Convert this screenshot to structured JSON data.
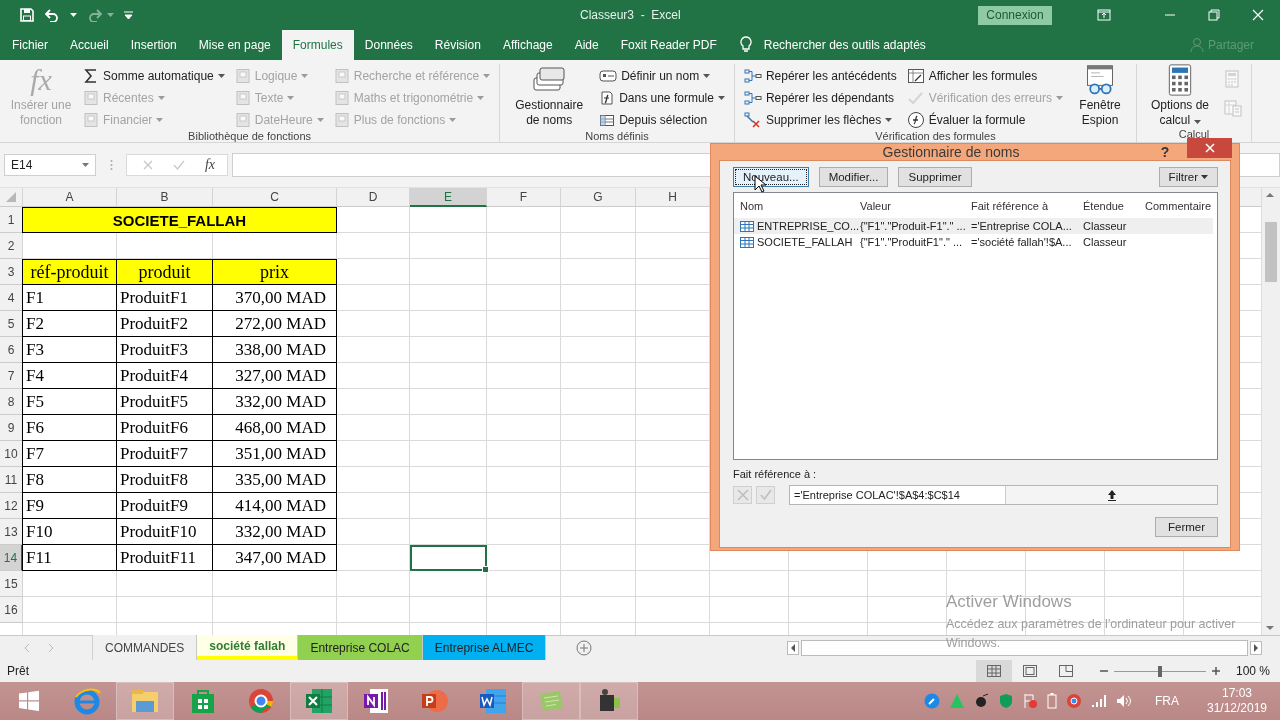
{
  "window": {
    "title": "Classeur3  -  Excel",
    "signin_button": "Connexion"
  },
  "ribbon_tabs": [
    {
      "label": "Fichier",
      "selected": false
    },
    {
      "label": "Accueil",
      "selected": false
    },
    {
      "label": "Insertion",
      "selected": false
    },
    {
      "label": "Mise en page",
      "selected": false
    },
    {
      "label": "Formules",
      "selected": true
    },
    {
      "label": "Données",
      "selected": false
    },
    {
      "label": "Révision",
      "selected": false
    },
    {
      "label": "Affichage",
      "selected": false
    },
    {
      "label": "Aide",
      "selected": false
    },
    {
      "label": "Foxit Reader PDF",
      "selected": false
    }
  ],
  "tell_me": "Rechercher des outils adaptés",
  "share": {
    "label": "Partager",
    "disabled": true
  },
  "ribbon_groups": [
    {
      "label": "Bibliothèque de fonctions",
      "controls": [
        {
          "kind": "large",
          "icon_text": "fx",
          "label": "Insérer une fonction",
          "disabled": true,
          "dropdown": false
        },
        {
          "kind": "column",
          "items": [
            {
              "label": "Somme automatique",
              "disabled": false,
              "dropdown": true
            },
            {
              "label": "Récentes",
              "disabled": true,
              "dropdown": true
            },
            {
              "label": "Financier",
              "disabled": true,
              "dropdown": true
            }
          ]
        },
        {
          "kind": "column",
          "items": [
            {
              "label": "Logique",
              "disabled": true,
              "dropdown": true
            },
            {
              "label": "Texte",
              "disabled": true,
              "dropdown": true
            },
            {
              "label": "DateHeure",
              "disabled": true,
              "dropdown": true
            }
          ]
        },
        {
          "kind": "column",
          "items": [
            {
              "label": "Recherche et référence",
              "disabled": true,
              "dropdown": true
            },
            {
              "label": "Maths et trigonométrie",
              "disabled": true,
              "dropdown": true
            },
            {
              "label": "Plus de fonctions",
              "disabled": true,
              "dropdown": true
            }
          ]
        }
      ]
    },
    {
      "label": "Noms définis",
      "controls": [
        {
          "kind": "large",
          "label": "Gestionnaire de noms",
          "disabled": false,
          "dropdown": false
        },
        {
          "kind": "column",
          "items": [
            {
              "label": "Définir un nom",
              "disabled": false,
              "dropdown": true
            },
            {
              "label": "Dans une formule",
              "disabled": false,
              "dropdown": true
            },
            {
              "label": "Depuis sélection",
              "disabled": false,
              "dropdown": false
            }
          ]
        }
      ]
    },
    {
      "label": "Vérification des formules",
      "controls": [
        {
          "kind": "column",
          "items": [
            {
              "label": "Repérer les antécédents",
              "disabled": false,
              "dropdown": false
            },
            {
              "label": "Repérer les dépendants",
              "disabled": false,
              "dropdown": false
            },
            {
              "label": "Supprimer les flèches",
              "disabled": false,
              "dropdown": true
            }
          ]
        },
        {
          "kind": "column",
          "items": [
            {
              "label": "Afficher les formules",
              "disabled": false,
              "dropdown": false
            },
            {
              "label": "Vérification des erreurs",
              "disabled": true,
              "dropdown": true
            },
            {
              "label": "Évaluer la formule",
              "disabled": false,
              "dropdown": false
            }
          ]
        },
        {
          "kind": "large",
          "label": "Fenêtre Espion",
          "disabled": false,
          "dropdown": false
        }
      ]
    },
    {
      "label": "Calcul",
      "controls": [
        {
          "kind": "large",
          "label": "Options de calcul",
          "disabled": false,
          "dropdown": true
        },
        {
          "kind": "icons",
          "items": [
            {
              "disabled": true
            },
            {
              "disabled": true
            }
          ]
        }
      ]
    }
  ],
  "formula_bar": {
    "name_box": "E14",
    "fx": "fx"
  },
  "columns": [
    {
      "label": "A",
      "selected": false
    },
    {
      "label": "B",
      "selected": false
    },
    {
      "label": "C",
      "selected": false
    },
    {
      "label": "D",
      "selected": false
    },
    {
      "label": "E",
      "selected": true
    },
    {
      "label": "F",
      "selected": false
    },
    {
      "label": "G",
      "selected": false
    },
    {
      "label": "H",
      "selected": false
    }
  ],
  "rows": [
    {
      "number": "1",
      "selected": false,
      "cells": [
        {
          "kind": "title",
          "text": "SOCIETE_FALLAH"
        }
      ]
    },
    {
      "number": "2",
      "selected": false
    },
    {
      "number": "3",
      "selected": false,
      "cells": [
        {
          "kind": "header",
          "text": "réf-produit"
        },
        {
          "kind": "header",
          "text": "produit"
        },
        {
          "kind": "header",
          "text": "prix"
        }
      ]
    },
    {
      "number": "4",
      "selected": false,
      "cells": [
        {
          "kind": "text",
          "text": "F1"
        },
        {
          "kind": "text",
          "text": "ProduitF1"
        },
        {
          "kind": "amount",
          "text": "370,00 MAD"
        }
      ]
    },
    {
      "number": "5",
      "selected": false,
      "cells": [
        {
          "kind": "text",
          "text": "F2"
        },
        {
          "kind": "text",
          "text": "ProduitF2"
        },
        {
          "kind": "amount",
          "text": "272,00 MAD"
        }
      ]
    },
    {
      "number": "6",
      "selected": false,
      "cells": [
        {
          "kind": "text",
          "text": "F3"
        },
        {
          "kind": "text",
          "text": "ProduitF3"
        },
        {
          "kind": "amount",
          "text": "338,00 MAD"
        }
      ]
    },
    {
      "number": "7",
      "selected": false,
      "cells": [
        {
          "kind": "text",
          "text": "F4"
        },
        {
          "kind": "text",
          "text": "ProduitF4"
        },
        {
          "kind": "amount",
          "text": "327,00 MAD"
        }
      ]
    },
    {
      "number": "8",
      "selected": false,
      "cells": [
        {
          "kind": "text",
          "text": "F5"
        },
        {
          "kind": "text",
          "text": "ProduitF5"
        },
        {
          "kind": "amount",
          "text": "332,00 MAD"
        }
      ]
    },
    {
      "number": "9",
      "selected": false,
      "cells": [
        {
          "kind": "text",
          "text": "F6"
        },
        {
          "kind": "text",
          "text": "ProduitF6"
        },
        {
          "kind": "amount",
          "text": "468,00 MAD"
        }
      ]
    },
    {
      "number": "10",
      "selected": false,
      "cells": [
        {
          "kind": "text",
          "text": "F7"
        },
        {
          "kind": "text",
          "text": "ProduitF7"
        },
        {
          "kind": "amount",
          "text": "351,00 MAD"
        }
      ]
    },
    {
      "number": "11",
      "selected": false,
      "cells": [
        {
          "kind": "text",
          "text": "F8"
        },
        {
          "kind": "text",
          "text": "ProduitF8"
        },
        {
          "kind": "amount",
          "text": "335,00 MAD"
        }
      ]
    },
    {
      "number": "12",
      "selected": false,
      "cells": [
        {
          "kind": "text",
          "text": "F9"
        },
        {
          "kind": "text",
          "text": "ProduitF9"
        },
        {
          "kind": "amount",
          "text": "414,00 MAD"
        }
      ]
    },
    {
      "number": "13",
      "selected": false,
      "cells": [
        {
          "kind": "text",
          "text": "F10"
        },
        {
          "kind": "text",
          "text": "ProduitF10"
        },
        {
          "kind": "amount",
          "text": "332,00 MAD"
        }
      ]
    },
    {
      "number": "14",
      "selected": true,
      "cells": [
        {
          "kind": "text",
          "text": "F11"
        },
        {
          "kind": "text",
          "text": "ProduitF11"
        },
        {
          "kind": "amount",
          "text": "347,00 MAD"
        }
      ]
    },
    {
      "number": "15",
      "selected": false
    },
    {
      "number": "16",
      "selected": false
    }
  ],
  "sheet_tabs": [
    {
      "label": "COMMANDES",
      "selected": false
    },
    {
      "label": "société fallah",
      "selected": true,
      "color": "#ffff00"
    },
    {
      "label": "Entreprise COLAC",
      "selected": false,
      "color": "#92d050"
    },
    {
      "label": "Entreprise ALMEC",
      "selected": false,
      "color": "#00b0f0"
    }
  ],
  "status": "Prêt",
  "views": [
    {
      "selected": true
    },
    {
      "selected": false
    },
    {
      "selected": false
    }
  ],
  "zoom": {
    "label": "100 %",
    "level": 0.5
  },
  "activation": {
    "title": "Activer Windows",
    "text": "Accédez aux paramètres de l'ordinateur pour activer Windows."
  },
  "name_manager": {
    "title": "Gestionnaire de noms",
    "help": "?",
    "buttons": [
      {
        "label": "Nouveau...",
        "focused": true
      },
      {
        "label": "Modifier...",
        "focused": false
      },
      {
        "label": "Supprimer",
        "focused": false
      }
    ],
    "filter_button": "Filtrer",
    "columns": [
      "Nom",
      "Valeur",
      "Fait référence à",
      "Étendue",
      "Commentaire"
    ],
    "names": [
      {
        "name": "ENTREPRISE_CO...",
        "value": "{\"F1\".\"Produit-F1\".\" ...",
        "refers_to": "='Entreprise COLA...",
        "scope": "Classeur",
        "selected": true
      },
      {
        "name": "SOCIETE_FALLAH",
        "value": "{\"F1\".\"ProduitF1\".\" ...",
        "refers_to": "='société fallah'!$A...",
        "scope": "Classeur",
        "selected": false
      }
    ],
    "refers_to_label": "Fait référence à :",
    "refers_to_value": "='Entreprise COLAC'!$A$4:$C$14",
    "close_button": "Fermer"
  },
  "taskbar_apps": [
    {
      "running": false
    },
    {
      "running": true
    },
    {
      "running": false
    },
    {
      "running": false
    },
    {
      "running": true
    },
    {
      "running": false
    },
    {
      "running": false
    },
    {
      "running": false
    },
    {
      "running": true
    },
    {
      "running": true
    }
  ],
  "tray": {
    "language": "FRA",
    "time": "17:03",
    "date": "31/12/2019"
  }
}
